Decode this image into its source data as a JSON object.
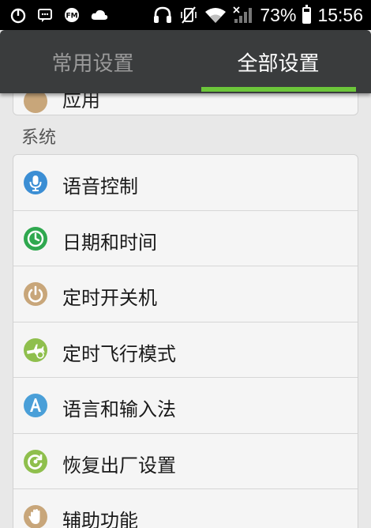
{
  "status_bar": {
    "battery_percent": "73%",
    "time": "15:56",
    "battery_level": 0.73,
    "icons_left": [
      "netease-icon",
      "message-icon",
      "fm-radio-icon",
      "cloud-icon"
    ],
    "icons_right": [
      "headset-icon",
      "vibrate-off-icon",
      "wifi-icon",
      "signal-icon",
      "battery-icon"
    ]
  },
  "tabs": [
    {
      "label": "常用设置",
      "active": false
    },
    {
      "label": "全部设置",
      "active": true
    }
  ],
  "partial_item": {
    "label": "应用",
    "icon": "apps-icon"
  },
  "section": {
    "title": "系统"
  },
  "items": [
    {
      "label": "语音控制",
      "icon": "microphone-icon",
      "color": "#3b8ed4"
    },
    {
      "label": "日期和时间",
      "icon": "clock-icon",
      "color": "#2fa84f"
    },
    {
      "label": "定时开关机",
      "icon": "power-icon",
      "color": "#c8a67a"
    },
    {
      "label": "定时飞行模式",
      "icon": "airplane-clock-icon",
      "color": "#8fbf4d"
    },
    {
      "label": "语言和输入法",
      "icon": "language-icon",
      "color": "#4a9fd8"
    },
    {
      "label": "恢复出厂设置",
      "icon": "factory-reset-icon",
      "color": "#8fbf4d"
    },
    {
      "label": "辅助功能",
      "icon": "hand-icon",
      "color": "#c8a67a"
    }
  ],
  "colors": {
    "tab_bar": "#3a3c3d",
    "tab_active_underline": "#6cc63a",
    "background": "#e8e8e8",
    "card": "#f5f5f5"
  }
}
